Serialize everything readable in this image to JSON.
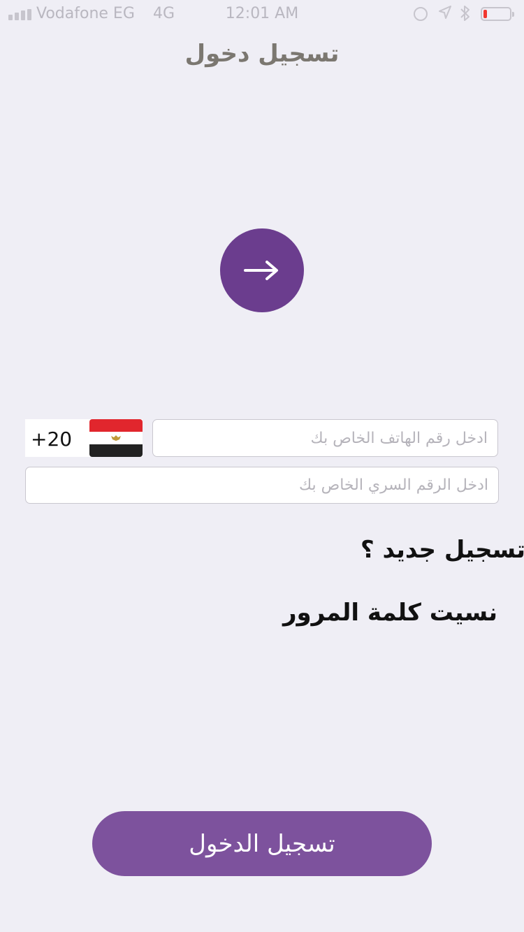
{
  "status_bar": {
    "carrier": "Vodafone EG",
    "network": "4G",
    "time": "12:01 AM",
    "signal_bars": 4,
    "battery_level_percent": 5,
    "icons": [
      "orientation-lock-icon",
      "location-icon",
      "bluetooth-icon",
      "battery-icon"
    ]
  },
  "header": {
    "title": "تسجيل دخول"
  },
  "arrow_button": {
    "icon": "arrow-right-icon",
    "color": "#6b3d8e"
  },
  "form": {
    "country_code": "+20",
    "country_flag": "egypt-flag-icon",
    "phone_placeholder": "ادخل رقم الهاتف الخاص بك",
    "password_placeholder": "ادخل الرقم السري الخاص بك"
  },
  "links": {
    "register": "تسجيل جديد ؟",
    "forgot_password": "نسيت كلمة المرور"
  },
  "login_button": {
    "label": "تسجيل الدخول",
    "color": "#7d529d"
  }
}
